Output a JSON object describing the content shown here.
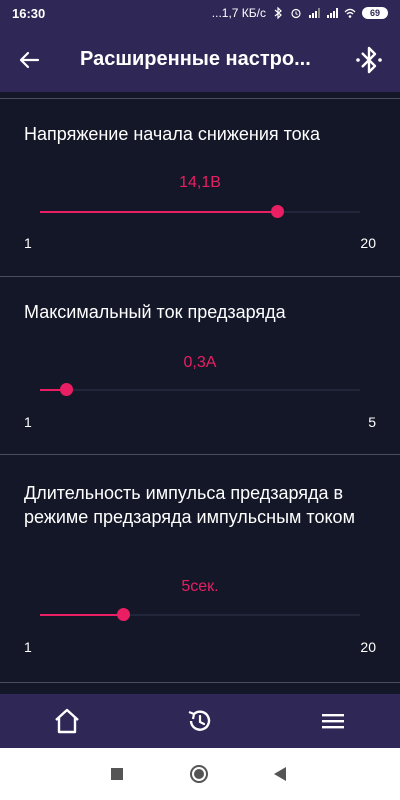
{
  "statusbar": {
    "time": "16:30",
    "network_speed": "...1,7 КБ/с",
    "battery": "69",
    "icons": [
      "bluetooth-icon",
      "alarm-icon",
      "signal-icon",
      "signal-icon",
      "wifi-icon",
      "battery-icon"
    ]
  },
  "appbar": {
    "title": "Расширенные настро...",
    "back_icon": "arrow-left-icon",
    "bluetooth_icon": "bluetooth-icon"
  },
  "sections": [
    {
      "title": "Напряжение начала снижения тока",
      "value": "14,1В",
      "min": "1",
      "max": "20",
      "level": 0.74
    },
    {
      "title": "Максимальный ток предзаряда",
      "value": "0,3А",
      "min": "1",
      "max": "5",
      "level": 0.08
    },
    {
      "title": "Длительность импульса предзаряда в режиме предзаряда импульсным током",
      "value": "5сек.",
      "min": "1",
      "max": "20",
      "level": 0.26
    }
  ],
  "bottom_nav": [
    "home-icon",
    "history-icon",
    "menu-icon"
  ],
  "system_nav": [
    "recents-square-icon",
    "home-circle-icon",
    "back-triangle-icon"
  ],
  "colors": {
    "background": "#141728",
    "bar": "#2f2755",
    "accent": "#e91e63",
    "divider": "#4a4d60"
  }
}
